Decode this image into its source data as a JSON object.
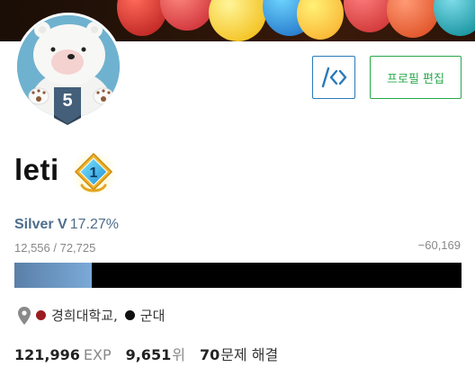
{
  "profile": {
    "username": "leti",
    "tier_level": "5",
    "class_level": "1",
    "tier_name": "Silver V",
    "tier_percent": "17.27%",
    "rating_progress": "12,556 / 72,725",
    "rating_remaining": "−60,169",
    "rating_progress_fraction": 0.1727,
    "edit_label": "프로필 편집",
    "code_button_icon": "code-icon",
    "schools": [
      {
        "name": "경희대학교,",
        "color": "#9b1c20"
      },
      {
        "name": "군대",
        "color": "#111111"
      }
    ],
    "stats": {
      "exp_value": "121,996",
      "exp_unit": "EXP",
      "rank_value": "9,651",
      "rank_unit": "위",
      "solved_value": "70",
      "solved_unit": "문제 해결"
    }
  },
  "colors": {
    "tier_silver": "#4e6d8c",
    "edit_green": "#27a84a",
    "code_blue": "#2a7ab8",
    "bar_track": "#000000",
    "bar_fill": "#6a95c4"
  }
}
